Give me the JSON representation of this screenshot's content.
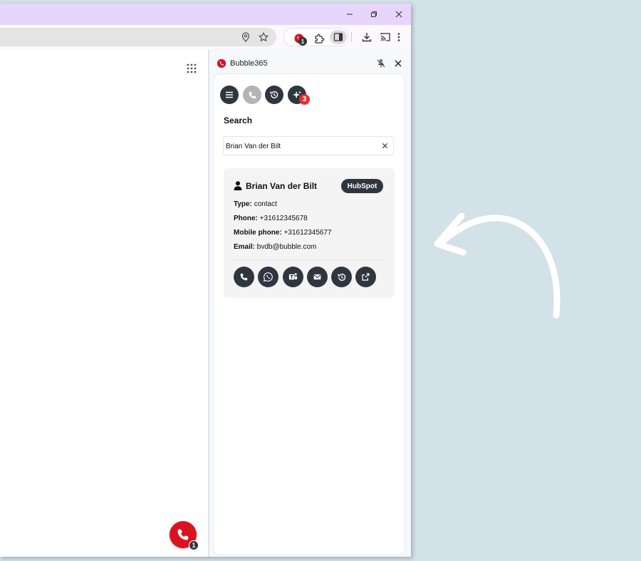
{
  "browser": {
    "extension_badge": "1"
  },
  "extension_panel": {
    "title": "Bubble365",
    "notification_badge": "3",
    "search": {
      "heading": "Search",
      "value": "Brian Van der Bilt"
    },
    "result": {
      "name": "Brian Van der Bilt",
      "source": "HubSpot",
      "fields": [
        {
          "label": "Type:",
          "value": "contact"
        },
        {
          "label": "Phone:",
          "value": "+31612345678"
        },
        {
          "label": "Mobile phone:",
          "value": "+31612345677"
        },
        {
          "label": "Email:",
          "value": "bvdb@bubble.com"
        }
      ],
      "actions": [
        "phone-icon",
        "whatsapp-icon",
        "teams-icon",
        "mail-icon",
        "history-icon",
        "external-link-icon"
      ]
    }
  },
  "floating_call_button": {
    "badge": "1"
  },
  "colors": {
    "brand_red": "#d8141f",
    "dark_button": "#2f3640",
    "title_bar": "#e8d5fb",
    "background": "#d3e1e9"
  }
}
